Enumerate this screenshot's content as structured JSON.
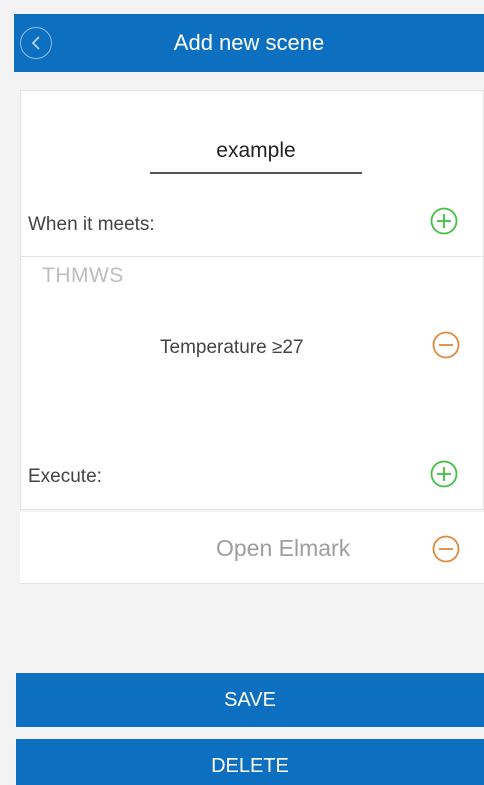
{
  "header": {
    "title": "Add new scene",
    "back_icon": "chevron-left-icon"
  },
  "scene": {
    "name": "example"
  },
  "conditions": {
    "label": "When it meets:",
    "device": "THMWS",
    "items": [
      {
        "text": "Temperature ≥27"
      }
    ]
  },
  "execute": {
    "label": "Execute:",
    "items": [
      {
        "text": "Open Elmark"
      }
    ]
  },
  "buttons": {
    "save": "SAVE",
    "delete": "DELETE"
  },
  "colors": {
    "primary": "#0d6fbf",
    "add": "#3fc23f",
    "remove": "#e0883b"
  }
}
